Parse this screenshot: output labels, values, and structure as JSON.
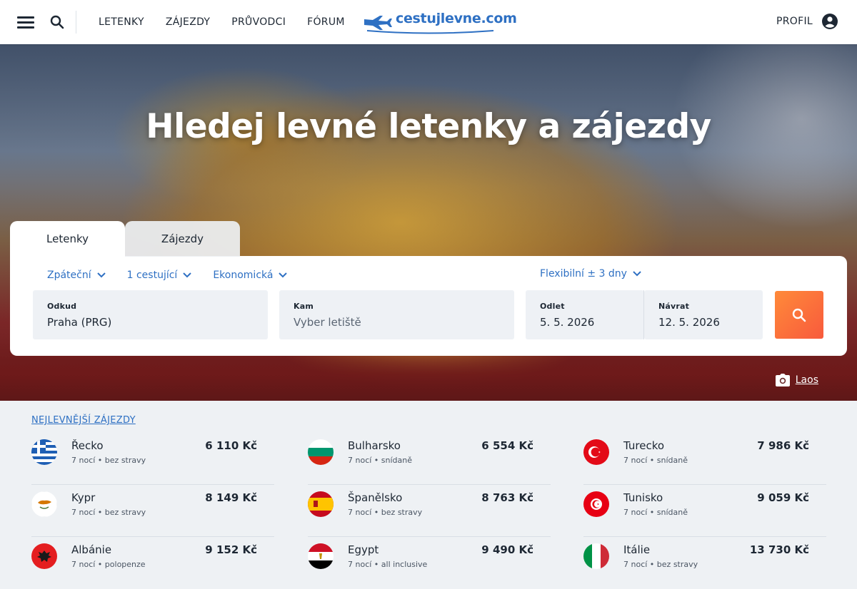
{
  "nav": {
    "links": [
      "LETENKY",
      "ZÁJEZDY",
      "PRŮVODCI",
      "FÓRUM"
    ],
    "logo_text": "cestujlevne.com",
    "profile_label": "PROFIL"
  },
  "hero": {
    "title": "Hledej levné letenky a zájezdy",
    "photo_credit": "Laos"
  },
  "search": {
    "tabs": [
      "Letenky",
      "Zájezdy"
    ],
    "active_tab": "Letenky",
    "trip_type": "Zpáteční",
    "travelers": "1 cestující",
    "cabin_class": "Ekonomická",
    "flexibility": "Flexibilní ± 3 dny",
    "from": {
      "label": "Odkud",
      "value": "Praha (PRG)"
    },
    "to": {
      "label": "Kam",
      "placeholder": "Vyber letiště"
    },
    "departure": {
      "label": "Odlet",
      "value": "5. 5. 2026"
    },
    "return": {
      "label": "Návrat",
      "value": "12. 5. 2026"
    }
  },
  "deals": {
    "heading": "NEJLEVNĚJŠÍ ZÁJEZDY",
    "items": [
      {
        "country": "Řecko",
        "nights": "7 nocí",
        "board": "bez stravy",
        "price": "6 110 Kč",
        "flag": "greece-flag-icon"
      },
      {
        "country": "Bulharsko",
        "nights": "7 nocí",
        "board": "snídaně",
        "price": "6 554 Kč",
        "flag": "bulgaria-flag-icon"
      },
      {
        "country": "Turecko",
        "nights": "7 nocí",
        "board": "snídaně",
        "price": "7 986 Kč",
        "flag": "turkey-flag-icon"
      },
      {
        "country": "Kypr",
        "nights": "7 nocí",
        "board": "bez stravy",
        "price": "8 149 Kč",
        "flag": "cyprus-flag-icon"
      },
      {
        "country": "Španělsko",
        "nights": "7 nocí",
        "board": "bez stravy",
        "price": "8 763 Kč",
        "flag": "spain-flag-icon"
      },
      {
        "country": "Tunisko",
        "nights": "7 nocí",
        "board": "snídaně",
        "price": "9 059 Kč",
        "flag": "tunisia-flag-icon"
      },
      {
        "country": "Albánie",
        "nights": "7 nocí",
        "board": "polopenze",
        "price": "9 152 Kč",
        "flag": "albania-flag-icon"
      },
      {
        "country": "Egypt",
        "nights": "7 nocí",
        "board": "all inclusive",
        "price": "9 490 Kč",
        "flag": "egypt-flag-icon"
      },
      {
        "country": "Itálie",
        "nights": "7 nocí",
        "board": "bez stravy",
        "price": "13 730 Kč",
        "flag": "italy-flag-icon"
      }
    ]
  },
  "colors": {
    "accent_blue": "#2e70c3",
    "search_button_start": "#ff8a3a",
    "search_button_end": "#f85a3c",
    "text_dark": "#1d2733"
  }
}
